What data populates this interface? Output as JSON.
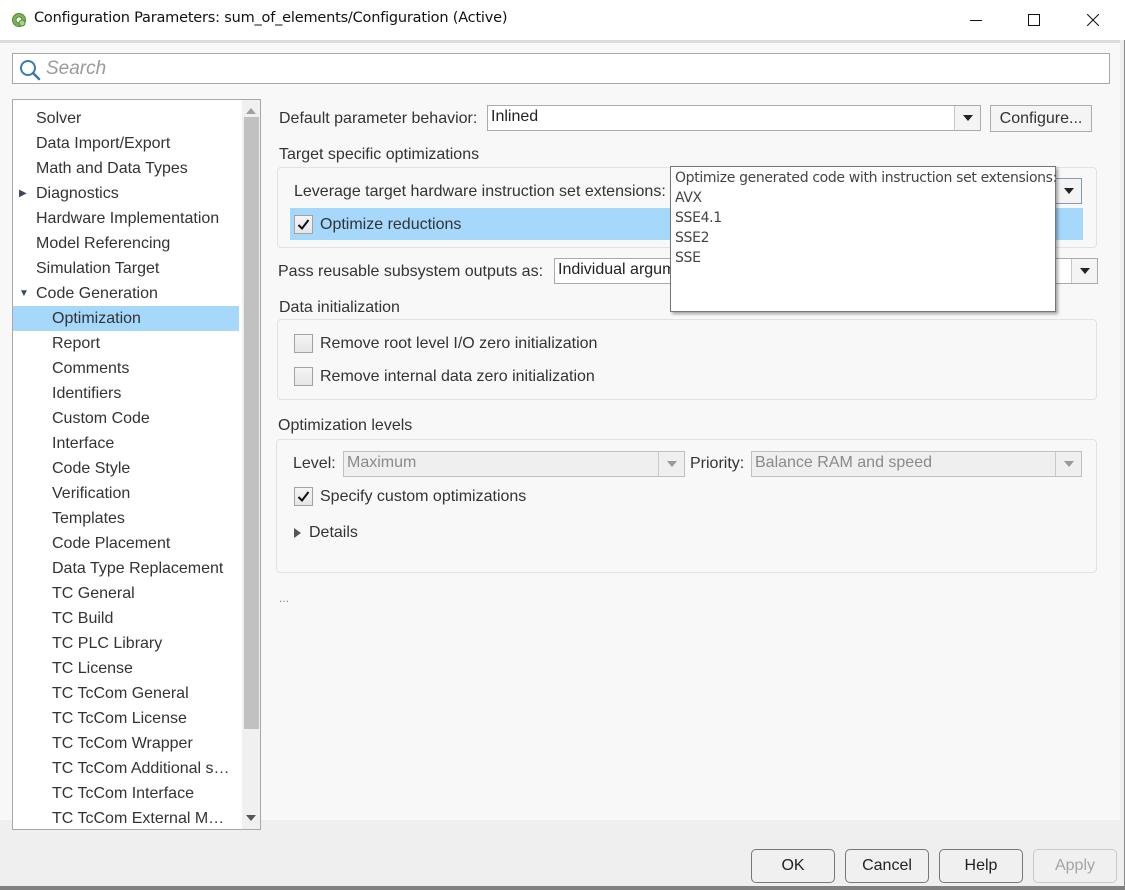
{
  "window": {
    "title": "Configuration Parameters: sum_of_elements/Configuration (Active)",
    "controls": {
      "minimize": "minimize-icon",
      "maximize": "maximize-icon",
      "close": "close-icon"
    }
  },
  "search": {
    "placeholder": "Search",
    "value": ""
  },
  "tree": {
    "items": [
      {
        "label": "Solver",
        "level": 0,
        "expander": "none"
      },
      {
        "label": "Data Import/Export",
        "level": 0,
        "expander": "none"
      },
      {
        "label": "Math and Data Types",
        "level": 0,
        "expander": "none"
      },
      {
        "label": "Diagnostics",
        "level": 0,
        "expander": "collapsed"
      },
      {
        "label": "Hardware Implementation",
        "level": 0,
        "expander": "none"
      },
      {
        "label": "Model Referencing",
        "level": 0,
        "expander": "none"
      },
      {
        "label": "Simulation Target",
        "level": 0,
        "expander": "none"
      },
      {
        "label": "Code Generation",
        "level": 0,
        "expander": "expanded"
      },
      {
        "label": "Optimization",
        "level": 1,
        "expander": "none",
        "selected": true
      },
      {
        "label": "Report",
        "level": 1,
        "expander": "none"
      },
      {
        "label": "Comments",
        "level": 1,
        "expander": "none"
      },
      {
        "label": "Identifiers",
        "level": 1,
        "expander": "none"
      },
      {
        "label": "Custom Code",
        "level": 1,
        "expander": "none"
      },
      {
        "label": "Interface",
        "level": 1,
        "expander": "none"
      },
      {
        "label": "Code Style",
        "level": 1,
        "expander": "none"
      },
      {
        "label": "Verification",
        "level": 1,
        "expander": "none"
      },
      {
        "label": "Templates",
        "level": 1,
        "expander": "none"
      },
      {
        "label": "Code Placement",
        "level": 1,
        "expander": "none"
      },
      {
        "label": "Data Type Replacement",
        "level": 1,
        "expander": "none"
      },
      {
        "label": "TC General",
        "level": 1,
        "expander": "none"
      },
      {
        "label": "TC Build",
        "level": 1,
        "expander": "none"
      },
      {
        "label": "TC PLC Library",
        "level": 1,
        "expander": "none"
      },
      {
        "label": "TC License",
        "level": 1,
        "expander": "none"
      },
      {
        "label": "TC TcCom General",
        "level": 1,
        "expander": "none"
      },
      {
        "label": "TC TcCom License",
        "level": 1,
        "expander": "none"
      },
      {
        "label": "TC TcCom Wrapper",
        "level": 1,
        "expander": "none"
      },
      {
        "label": "TC TcCom Additional s…",
        "level": 1,
        "expander": "none"
      },
      {
        "label": "TC TcCom Interface",
        "level": 1,
        "expander": "none"
      },
      {
        "label": "TC TcCom External M…",
        "level": 1,
        "expander": "none"
      }
    ]
  },
  "main": {
    "default_param": {
      "label": "Default parameter behavior:",
      "value": "Inlined",
      "configure_label": "Configure..."
    },
    "target_specific": {
      "title": "Target specific optimizations",
      "leverage_label": "Leverage target hardware instruction set extensions:",
      "leverage_value": "AVX",
      "optimize_reductions": {
        "label": "Optimize reductions",
        "checked": true
      }
    },
    "dropdown_popup": {
      "hint": "Optimize generated code with instruction set extensions:",
      "options": [
        "AVX",
        "SSE4.1",
        "SSE2",
        "SSE"
      ]
    },
    "pass_reusable": {
      "label": "Pass reusable subsystem outputs as:",
      "value": "Individual argum"
    },
    "data_init": {
      "title": "Data initialization",
      "remove_root": {
        "label": "Remove root level I/O zero initialization",
        "checked": false
      },
      "remove_internal": {
        "label": "Remove internal data zero initialization",
        "checked": false
      }
    },
    "opt_levels": {
      "title": "Optimization levels",
      "level_label": "Level:",
      "level_value": "Maximum",
      "priority_label": "Priority:",
      "priority_value": "Balance RAM and speed",
      "custom": {
        "label": "Specify custom optimizations",
        "checked": true
      },
      "details_label": "Details"
    },
    "ellipsis": "..."
  },
  "footer": {
    "ok": "OK",
    "cancel": "Cancel",
    "help": "Help",
    "apply": "Apply"
  }
}
